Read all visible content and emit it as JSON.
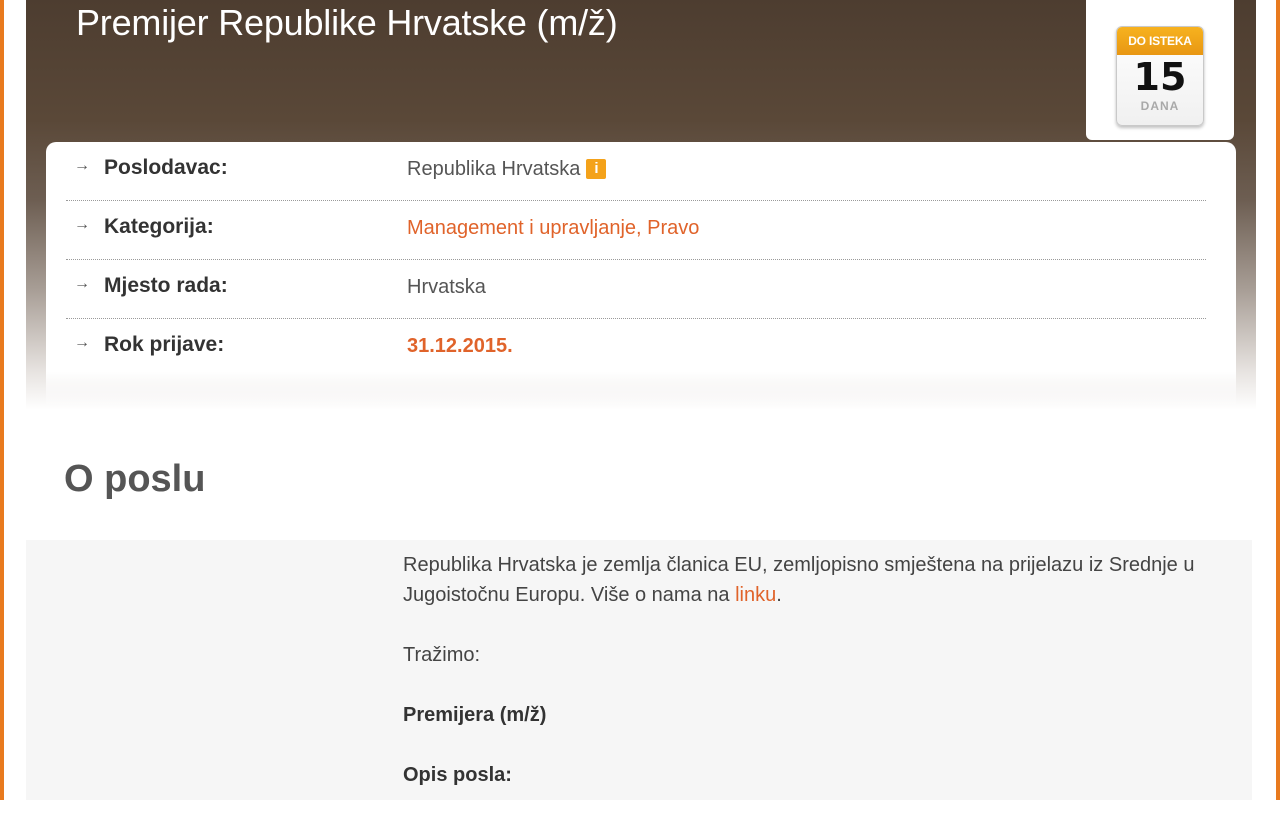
{
  "job": {
    "title": "Premijer Republike Hrvatske (m/ž)"
  },
  "expiry_badge": {
    "header": "DO ISTEKA",
    "number": "15",
    "unit": "DANA"
  },
  "details": {
    "employer": {
      "label": "Poslodavac:",
      "value": "Republika Hrvatska",
      "info_icon": "i"
    },
    "category": {
      "label": "Kategorija:",
      "value_1": "Management i upravljanje",
      "separator": ", ",
      "value_2": "Pravo"
    },
    "location": {
      "label": "Mjesto rada:",
      "value": "Hrvatska"
    },
    "deadline": {
      "label": "Rok prijave:",
      "value": "31.12.2015."
    }
  },
  "about": {
    "heading": "O poslu",
    "intro_text": "Republika Hrvatska je zemlja članica EU, zemljopisno smještena na prijelazu iz Srednje u Jugoistočnu Europu. Više o nama na ",
    "intro_link": "linku",
    "intro_end": ".",
    "seeking": "Tražimo:",
    "position": "Premijera (m/ž)",
    "description_heading": "Opis posla:"
  },
  "colors": {
    "accent": "#e0632a",
    "frame": "#e87a1e",
    "header_dark": "#4d3d30",
    "badge": "#f4a21a"
  }
}
